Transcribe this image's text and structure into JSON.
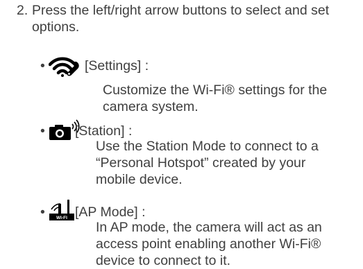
{
  "step": {
    "number": "2.",
    "text": "Press the left/right arrow buttons to select and set options."
  },
  "options": [
    {
      "icon": "wifi-settings-icon",
      "title": "[Settings] :",
      "description": "Customize the Wi-Fi® settings for the camera system."
    },
    {
      "icon": "camera-station-icon",
      "title": "[Station] :",
      "description": "Use the Station Mode to connect to a “Personal Hotspot” created by your mobile device."
    },
    {
      "icon": "wifi-ap-mode-icon",
      "title": "[AP Mode] :",
      "description": "In AP mode, the camera will act as an access point enabling another Wi-Fi® device to connect to it."
    }
  ],
  "colors": {
    "text": "#404040",
    "icon": "#000000"
  }
}
